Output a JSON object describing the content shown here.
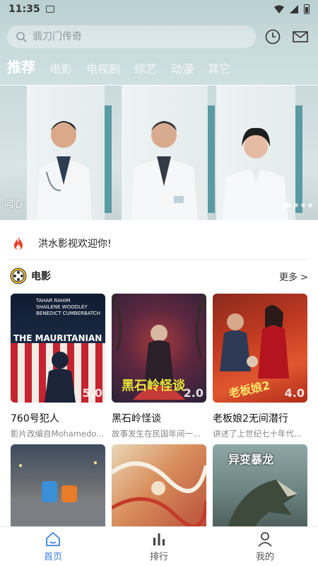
{
  "status": {
    "time": "11:35"
  },
  "search": {
    "placeholder": "翡刀门传奇"
  },
  "tabs": [
    {
      "label": "推荐",
      "active": true
    },
    {
      "label": "电影"
    },
    {
      "label": "电视剧"
    },
    {
      "label": "综艺"
    },
    {
      "label": "动漫"
    },
    {
      "label": "其它"
    }
  ],
  "banner": {
    "title": "问心",
    "dots": 4,
    "active_dot": 0
  },
  "welcome": {
    "text": "洪水影视欢迎你!"
  },
  "section": {
    "title": "电影",
    "more": "更多 >"
  },
  "movies": [
    {
      "title": "760号犯人",
      "desc": "影片改编自Mohamedo...",
      "score": "5.0",
      "poster_text": "THE MAURITANIAN",
      "poster_credits": [
        "TAHAR RAHIM",
        "SHAILENE WOODLEY",
        "BENEDICT CUMBERBATCH"
      ]
    },
    {
      "title": "黑石岭怪谈",
      "desc": "故事发生在民国年间一...",
      "score": "2.0",
      "poster_text": "黑石岭怪谈"
    },
    {
      "title": "老板娘2无间潜行",
      "desc": "讲述了上世纪七十年代...",
      "score": "4.0",
      "poster_text": "老板娘2"
    }
  ],
  "row2": [
    {
      "poster_text": ""
    },
    {
      "poster_text": ""
    },
    {
      "poster_text": "异变暴龙"
    }
  ],
  "nav": [
    {
      "label": "首页",
      "active": true
    },
    {
      "label": "排行"
    },
    {
      "label": "我的"
    }
  ],
  "colors": {
    "accent": "#3d7fe0",
    "fire": "#e8402b",
    "banner_frame": "#5a9aa3"
  }
}
